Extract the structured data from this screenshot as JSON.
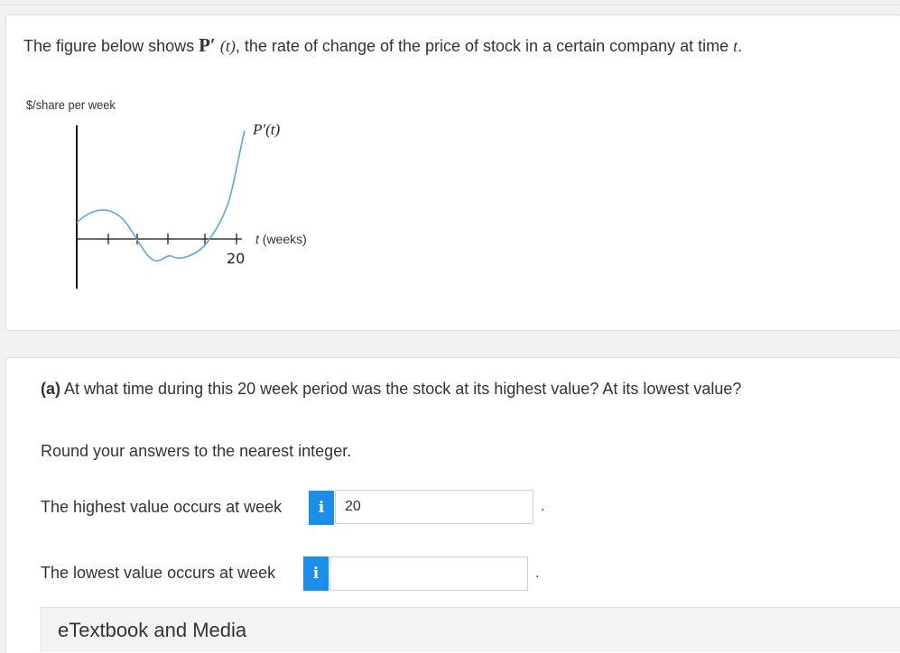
{
  "intro": {
    "prefix": "The figure below shows ",
    "func": "P′",
    "arg": "(t)",
    "suffix": ", the rate of change of the price of stock in a certain company at time ",
    "var": "t",
    "end": "."
  },
  "figure": {
    "y_axis_label": "$/share per week",
    "curve_label": "P′(t)",
    "x_axis_var": "t",
    "x_axis_unit": "(weeks)",
    "x_tick_label": "20"
  },
  "part_a": {
    "label": "(a)",
    "question": "At what time during this 20 week period was the stock at its highest value? At its lowest value?",
    "instruction": "Round your answers to the nearest integer.",
    "highest_prompt": "The highest value occurs at week",
    "highest_value": "20",
    "lowest_prompt": "The lowest value occurs at week",
    "lowest_value": "",
    "info_glyph": "i",
    "period": "."
  },
  "footer": {
    "etextbook_label": "eTextbook and Media"
  },
  "colors": {
    "info_button": "#1a8ee8",
    "curve": "#5aa8dc"
  }
}
